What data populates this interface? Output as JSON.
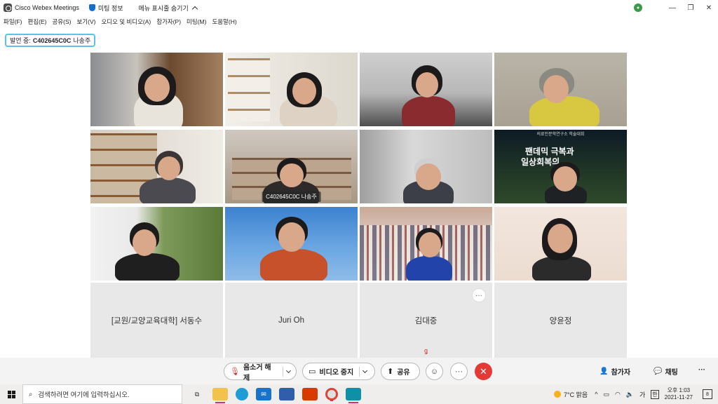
{
  "window": {
    "app_title": "Cisco Webex Meetings",
    "meeting_info": "미팅 정보",
    "hide_menu": "메뉴 표시줄 숨기기"
  },
  "menu": [
    "파일(F)",
    "편집(E)",
    "공유(S)",
    "보기(V)",
    "오디오 및 비디오(A)",
    "참가자(P)",
    "미팅(M)",
    "도움말(H)"
  ],
  "speaking": {
    "prefix": "발언 중:",
    "id": "C402645C0C",
    "name": "나송주"
  },
  "video_tiles": [
    {
      "label": ""
    },
    {
      "label": ""
    },
    {
      "label": ""
    },
    {
      "label": ""
    },
    {
      "label": ""
    },
    {
      "label": "C402645C0C 나송주"
    },
    {
      "label": ""
    },
    {
      "label": ""
    },
    {
      "label": ""
    },
    {
      "label": ""
    },
    {
      "label": ""
    },
    {
      "label": ""
    }
  ],
  "slide": {
    "title_line1": "팬데믹 극복과",
    "title_line2": "일상회복의",
    "header": "의료인문학연구소 학술대회"
  },
  "name_tiles": [
    "[교원/교양교육대학] 서동수",
    "Juri Oh",
    "김대중",
    "양윤정"
  ],
  "controls": {
    "unmute": "음소거 해제",
    "stop_video": "비디오 중지",
    "share": "공유",
    "participants": "참가자",
    "chat": "채팅"
  },
  "taskbar": {
    "search_placeholder": "검색하려면 여기에 입력하십시오.",
    "weather": "7°C  맑음",
    "ime": "가",
    "lang": "한",
    "time": "오후 1:03",
    "date": "2021-11-27",
    "notifications": "8"
  },
  "colors": {
    "accent": "#32b4e0",
    "end": "#e53935",
    "webex_blue": "#1170cf"
  }
}
